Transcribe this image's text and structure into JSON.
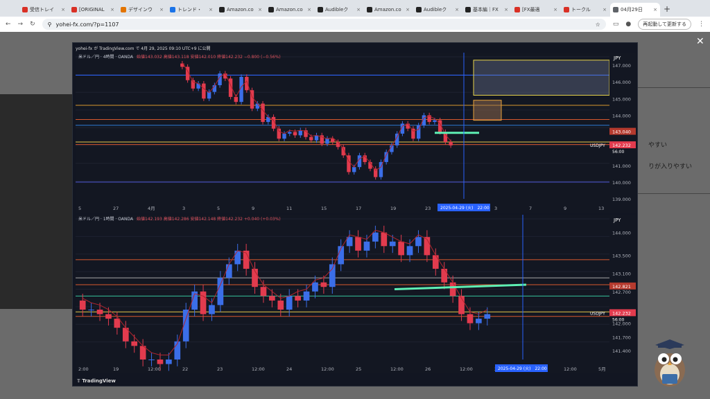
{
  "browser": {
    "tabs": [
      {
        "label": "受信トレイ",
        "color": "#d93025"
      },
      {
        "label": "[ORIGINAL",
        "color": "#d93025"
      },
      {
        "label": "デザインウ",
        "color": "#e37400"
      },
      {
        "label": "トレンド・",
        "color": "#1a73e8"
      },
      {
        "label": "Amazon.co",
        "color": "#222"
      },
      {
        "label": "Amazon.co",
        "color": "#222"
      },
      {
        "label": "Audibleク",
        "color": "#222"
      },
      {
        "label": "Amazon.co",
        "color": "#222"
      },
      {
        "label": "Audibleク",
        "color": "#222"
      },
      {
        "label": "基本編｜FX",
        "color": "#222"
      },
      {
        "label": "[FX最適",
        "color": "#d93025"
      },
      {
        "label": "トークル",
        "color": "#d93025"
      },
      {
        "label": "04月29日",
        "color": "#5f6368",
        "active": true
      }
    ],
    "new_tab": "+",
    "url": "yohei-fx.com/?p=1107",
    "relaunch_label": "再起動して更新する"
  },
  "background_page": {
    "text1": "やすい",
    "text2": "りが入りやすい"
  },
  "lightbox": {
    "header": "yohei-fx が TradingView.com で 4月 29, 2025 09:10 UTC+9 に公開",
    "footer": "TradingView",
    "close": "✕"
  },
  "chart_data": [
    {
      "type": "candlestick",
      "title": "米ドル／円 · 4時間 · OANDA",
      "ohlc": "始値143.032 高値143.118 安値142.010 終値142.232 −0.800 (−0.56%)",
      "currency": "JPY",
      "y_ticks": [
        "147.000",
        "146.000",
        "145.000",
        "144.000",
        "143.040",
        "142.232",
        "141.000",
        "140.000",
        "139.000"
      ],
      "price_label": "142.232",
      "price_sublabel": "56:00",
      "marker_price": "143.040",
      "symbol_tag": "USDJPY",
      "x_ticks": [
        "5",
        "27",
        "4月",
        "3",
        "5",
        "9",
        "11",
        "15",
        "17",
        "19",
        "23",
        "25",
        "3",
        "7",
        "9",
        "13"
      ],
      "x_highlight": "2025-04-29 (火)　22:00",
      "ylim": [
        139.0,
        147.5
      ],
      "closes": [
        146.9,
        146.1,
        145.6,
        145.9,
        145.0,
        145.4,
        145.8,
        146.5,
        146.2,
        145.1,
        144.8,
        146.3,
        145.5,
        144.4,
        144.7,
        143.6,
        143.9,
        143.2,
        142.6,
        142.9,
        143.0,
        142.8,
        143.1,
        142.7,
        142.5,
        142.8,
        142.3,
        142.6,
        142.4,
        142.1,
        141.6,
        140.6,
        140.9,
        141.6,
        141.2,
        140.8,
        140.3,
        141.2,
        141.8,
        142.2,
        142.9,
        143.5,
        143.2,
        142.6,
        143.4,
        144.0,
        143.6,
        143.7,
        143.0,
        142.4,
        142.2
      ]
    },
    {
      "type": "candlestick",
      "title": "米ドル／円 · 1時間 · OANDA",
      "ohlc": "始値142.193 高値142.286 安値142.148 終値142.232 +0.040 (+0.03%)",
      "currency": "JPY",
      "y_ticks": [
        "144.000",
        "143.500",
        "143.100",
        "142.821",
        "142.700",
        "142.232",
        "142.000",
        "141.700",
        "141.400"
      ],
      "price_label": "142.232",
      "price_sublabel": "56:00",
      "marker_price": "142.821",
      "symbol_tag": "USDJPY",
      "x_ticks": [
        "2:00",
        "19",
        "12:00",
        "22",
        "23",
        "12:00",
        "24",
        "12:00",
        "25",
        "12:00",
        "26",
        "12:00",
        "29",
        "12",
        "12:00",
        "5月"
      ],
      "x_highlight": "2025-04-29 (火)　22:00",
      "ylim": [
        141.2,
        144.3
      ],
      "closes": [
        142.3,
        142.3,
        142.2,
        142.1,
        141.9,
        141.6,
        141.5,
        141.2,
        141.2,
        141.1,
        141.2,
        141.6,
        142.3,
        142.7,
        142.2,
        142.4,
        143.0,
        143.3,
        143.6,
        143.2,
        142.8,
        142.6,
        142.5,
        142.3,
        142.6,
        142.5,
        142.7,
        142.9,
        142.8,
        143.3,
        143.7,
        143.9,
        143.6,
        143.8,
        144.0,
        143.7,
        143.8,
        143.5,
        143.7,
        143.9,
        143.5,
        143.2,
        142.9,
        142.6,
        142.2,
        142.0,
        142.1,
        142.2
      ]
    }
  ]
}
